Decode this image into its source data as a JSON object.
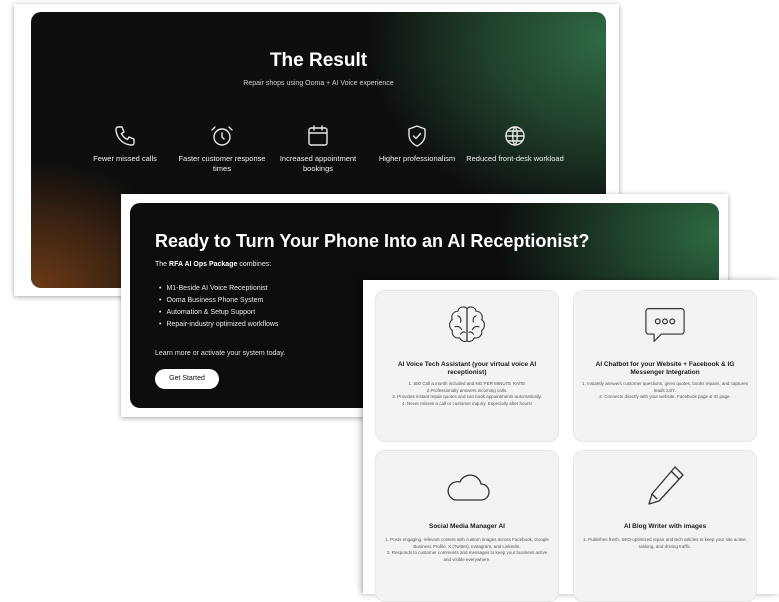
{
  "result": {
    "title": "The Result",
    "subtitle": "Repair shops using Ooma + AI Voice experience",
    "features": [
      {
        "icon": "phone-icon",
        "label": "Fewer missed calls"
      },
      {
        "icon": "stopwatch-icon",
        "label": "Faster customer response times"
      },
      {
        "icon": "calendar-icon",
        "label": "Increased appointment bookings"
      },
      {
        "icon": "shield-check-icon",
        "label": "Higher professionalism"
      },
      {
        "icon": "globe-icon",
        "label": "Reduced front-desk workload"
      }
    ]
  },
  "cta": {
    "title": "Ready to Turn Your Phone Into an AI Receptionist?",
    "intro_prefix": "The",
    "intro_bold": "RFA AI Ops Package",
    "intro_suffix": "combines:",
    "list": [
      "M1-Beside AI Voice Receptionist",
      "Ooma Business Phone System",
      "Automation & Setup Support",
      "Repair-industry optimized workflows"
    ],
    "note": "Learn more or activate your system today.",
    "button": "Get Started"
  },
  "services": [
    {
      "icon": "brain-icon",
      "title": "AI Voice Tech Assistant (your virtual voice AI receptionist)",
      "lines": [
        "1. 500 Call a month included and NO PER MINUTE RATE!",
        "2.Professionally answers incoming calls.",
        "3. Provides instant repair quotes and can book appointments automatically.",
        "4. Never misses a call or customer inquiry. Especially after hours!"
      ]
    },
    {
      "icon": "chat-bubble-icon",
      "title": "AI Chatbot for your Website + Facebook & IG Messenger Integration",
      "lines": [
        "1. Instantly answers customer questions, gives quotes, books repairs, and captures leads 24/7.",
        "2. Connects directly with your website, Facebook page & IG page."
      ]
    },
    {
      "icon": "cloud-icon",
      "title": "Social Media Manager AI",
      "lines": [
        "1. Posts engaging, relevant content with custom images across Facebook, Google Business Profile, X (Twitter), Instagram, and LinkedIn.",
        "2. Responds to customer comments and messages to keep your business active and visible everywhere."
      ]
    },
    {
      "icon": "pencil-icon",
      "title": "AI Blog Writer with images",
      "lines": [
        "1. Publishes fresh, SEO-optimized repair and tech articles to keep your site active, ranking, and driving traffic."
      ]
    }
  ]
}
